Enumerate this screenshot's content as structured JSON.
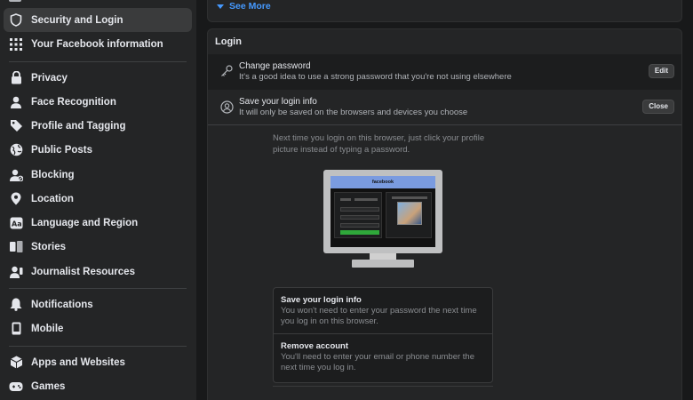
{
  "sidebar": {
    "items": [
      {
        "label": "Security and Login",
        "icon": "shield-icon"
      },
      {
        "label": "Your Facebook information",
        "icon": "grid-icon"
      },
      {
        "label": "Privacy",
        "icon": "lock-icon"
      },
      {
        "label": "Face Recognition",
        "icon": "person-icon"
      },
      {
        "label": "Profile and Tagging",
        "icon": "tag-icon"
      },
      {
        "label": "Public Posts",
        "icon": "globe-icon"
      },
      {
        "label": "Blocking",
        "icon": "block-user-icon"
      },
      {
        "label": "Location",
        "icon": "location-pin-icon"
      },
      {
        "label": "Language and Region",
        "icon": "language-icon"
      },
      {
        "label": "Stories",
        "icon": "book-icon"
      },
      {
        "label": "Journalist Resources",
        "icon": "journalist-icon"
      },
      {
        "label": "Notifications",
        "icon": "bell-icon"
      },
      {
        "label": "Mobile",
        "icon": "mobile-icon"
      },
      {
        "label": "Apps and Websites",
        "icon": "cube-icon"
      },
      {
        "label": "Games",
        "icon": "gamepad-icon"
      }
    ],
    "active_index": 0
  },
  "main": {
    "see_more": "See More",
    "login_card": {
      "title": "Login",
      "change_password": {
        "title": "Change password",
        "desc": "It's a good idea to use a strong password that you're not using elsewhere",
        "button": "Edit"
      },
      "save_login": {
        "title": "Save your login info",
        "desc": "It will only be saved on the browsers and devices you choose",
        "button": "Close"
      },
      "info_text": "Next time you login on this browser, just click your profile picture instead of typing a password.",
      "illustration_brand": "facebook",
      "options": [
        {
          "title": "Save your login info",
          "desc": "You won't need to enter your password the next time you log in on this browser."
        },
        {
          "title": "Remove account",
          "desc": "You'll need to enter your email or phone number the next time you log in."
        }
      ]
    }
  },
  "colors": {
    "accent": "#4599ff",
    "background": "#18191a",
    "surface": "#242526"
  }
}
